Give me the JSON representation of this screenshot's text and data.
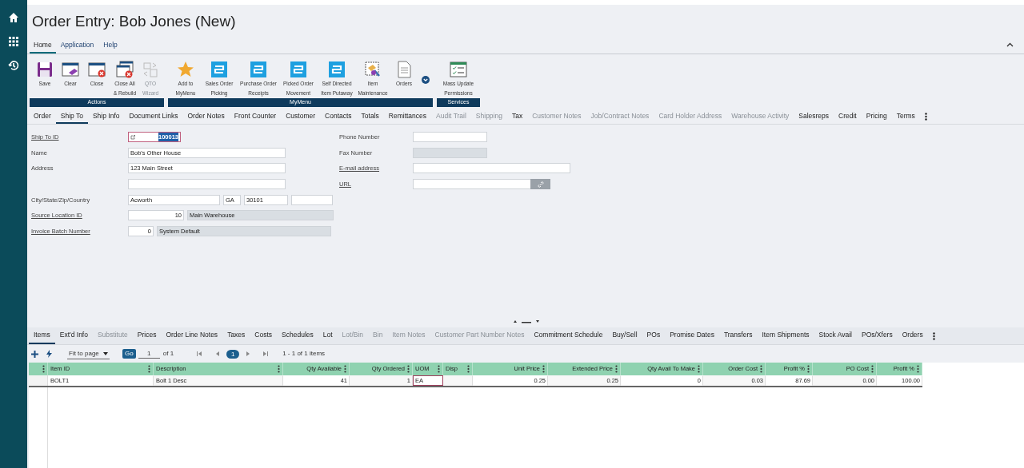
{
  "title": "Order Entry: Bob Jones (New)",
  "menu_tabs": [
    {
      "label": "Home",
      "selected": true
    },
    {
      "label": "Application",
      "selected": false
    },
    {
      "label": "Help",
      "selected": false
    }
  ],
  "ribbon": [
    {
      "label": "Actions",
      "buttons": [
        {
          "kind": "save",
          "label": "Save",
          "disabled": false
        },
        {
          "kind": "clear",
          "label": "Clear",
          "disabled": false
        },
        {
          "kind": "close",
          "label": "Close",
          "disabled": false
        },
        {
          "kind": "closeall",
          "label": "Close All\n& Rebuild",
          "disabled": false
        },
        {
          "kind": "qto",
          "label": "QTO\nWizard",
          "disabled": true
        }
      ]
    },
    {
      "label": "MyMenu",
      "more": true,
      "buttons": [
        {
          "kind": "star",
          "label": "Add to\nMyMenu",
          "disabled": false
        },
        {
          "kind": "tile",
          "label": "Sales Order\nPicking",
          "disabled": false
        },
        {
          "kind": "tile",
          "label": "Purchase Order\nReceipts",
          "disabled": false
        },
        {
          "kind": "tile",
          "label": "Picked Order\nMovement",
          "disabled": false
        },
        {
          "kind": "tile",
          "label": "Self Directed\nItem Putaway",
          "disabled": false
        },
        {
          "kind": "item",
          "label": "Item\nMaintenance",
          "disabled": false
        },
        {
          "kind": "doc",
          "label": "Orders",
          "disabled": false
        }
      ]
    },
    {
      "label": "Services",
      "buttons": [
        {
          "kind": "checklist",
          "label": "Mass Update\nPermissions",
          "disabled": false
        }
      ]
    }
  ],
  "tabs": [
    {
      "label": "Order",
      "selected": false,
      "disabled": false
    },
    {
      "label": "Ship To",
      "selected": true,
      "disabled": false
    },
    {
      "label": "Ship Info",
      "selected": false,
      "disabled": false
    },
    {
      "label": "Document Links",
      "selected": false,
      "disabled": false
    },
    {
      "label": "Order Notes",
      "selected": false,
      "disabled": false
    },
    {
      "label": "Front Counter",
      "selected": false,
      "disabled": false
    },
    {
      "label": "Customer",
      "selected": false,
      "disabled": false
    },
    {
      "label": "Contacts",
      "selected": false,
      "disabled": false
    },
    {
      "label": "Totals",
      "selected": false,
      "disabled": false
    },
    {
      "label": "Remittances",
      "selected": false,
      "disabled": false
    },
    {
      "label": "Audit Trail",
      "selected": false,
      "disabled": true
    },
    {
      "label": "Shipping",
      "selected": false,
      "disabled": true
    },
    {
      "label": "Tax",
      "selected": false,
      "disabled": false
    },
    {
      "label": "Customer Notes",
      "selected": false,
      "disabled": true
    },
    {
      "label": "Job/Contract Notes",
      "selected": false,
      "disabled": true
    },
    {
      "label": "Card Holder Address",
      "selected": false,
      "disabled": true
    },
    {
      "label": "Warehouse Activity",
      "selected": false,
      "disabled": true
    },
    {
      "label": "Salesreps",
      "selected": false,
      "disabled": false
    },
    {
      "label": "Credit",
      "selected": false,
      "disabled": false
    },
    {
      "label": "Pricing",
      "selected": false,
      "disabled": false
    },
    {
      "label": "Terms",
      "selected": false,
      "disabled": false
    }
  ],
  "form_left": [
    {
      "label": "Ship To ID",
      "link": true,
      "inputs": [
        {
          "kind": "lookup",
          "value": "100013",
          "focused": true
        }
      ]
    },
    {
      "label": "Name",
      "link": false,
      "inputs": [
        {
          "kind": "text",
          "value": "Bob's Other House",
          "focused": false
        }
      ]
    },
    {
      "label": "Address",
      "link": false,
      "inputs": [
        {
          "kind": "text",
          "value": "123 Main Street",
          "focused": false
        }
      ]
    },
    {
      "inputs": [
        {
          "kind": "text",
          "focused": false
        }
      ]
    },
    {
      "label": "City/State/Zip/Country",
      "link": false,
      "inputs": [
        {
          "kind": "text",
          "value": "Acworth",
          "focused": false
        },
        {
          "kind": "text",
          "value": "GA",
          "focused": false
        },
        {
          "kind": "text",
          "value": "30101",
          "focused": false
        },
        {
          "kind": "text",
          "focused": false
        }
      ]
    },
    {
      "label": "Source Location ID",
      "link": true,
      "inputs": [
        {
          "kind": "number",
          "value": "10",
          "focused": false
        },
        {
          "kind": "readonly",
          "value": "Main Warehouse",
          "focused": false
        }
      ]
    },
    {
      "label": "Invoice Batch Number",
      "link": true,
      "inputs": [
        {
          "kind": "number",
          "value": "0",
          "focused": false
        },
        {
          "kind": "readonly",
          "value": "System Default",
          "focused": false
        }
      ]
    }
  ],
  "form_right": [
    {
      "label": "Phone Number",
      "link": false,
      "inputs": [
        {
          "kind": "text",
          "focused": false
        }
      ]
    },
    {
      "label": "Fax Number",
      "link": false,
      "inputs": [
        {
          "kind": "readonly",
          "focused": false
        }
      ]
    },
    {
      "label": "E-mail address",
      "link": true,
      "inputs": [
        {
          "kind": "text",
          "focused": false
        }
      ]
    },
    {
      "label": "URL",
      "link": true,
      "inputs": [
        {
          "kind": "url",
          "focused": false
        }
      ]
    }
  ],
  "item_tabs": [
    {
      "label": "Items",
      "selected": true,
      "disabled": false
    },
    {
      "label": "Ext'd Info",
      "selected": false,
      "disabled": false
    },
    {
      "label": "Substitute",
      "selected": false,
      "disabled": true
    },
    {
      "label": "Prices",
      "selected": false,
      "disabled": false
    },
    {
      "label": "Order Line Notes",
      "selected": false,
      "disabled": false
    },
    {
      "label": "Taxes",
      "selected": false,
      "disabled": false
    },
    {
      "label": "Costs",
      "selected": false,
      "disabled": false
    },
    {
      "label": "Schedules",
      "selected": false,
      "disabled": false
    },
    {
      "label": "Lot",
      "selected": false,
      "disabled": false
    },
    {
      "label": "Lot/Bin",
      "selected": false,
      "disabled": true
    },
    {
      "label": "Bin",
      "selected": false,
      "disabled": true
    },
    {
      "label": "Item Notes",
      "selected": false,
      "disabled": true
    },
    {
      "label": "Customer Part Number Notes",
      "selected": false,
      "disabled": true
    },
    {
      "label": "Commitment Schedule",
      "selected": false,
      "disabled": false
    },
    {
      "label": "Buy/Sell",
      "selected": false,
      "disabled": false
    },
    {
      "label": "POs",
      "selected": false,
      "disabled": false
    },
    {
      "label": "Promise Dates",
      "selected": false,
      "disabled": false
    },
    {
      "label": "Transfers",
      "selected": false,
      "disabled": false
    },
    {
      "label": "Item Shipments",
      "selected": false,
      "disabled": false
    },
    {
      "label": "Stock Avail",
      "selected": false,
      "disabled": false
    },
    {
      "label": "POs/Xfers",
      "selected": false,
      "disabled": false
    },
    {
      "label": "Orders",
      "selected": false,
      "disabled": false
    }
  ],
  "pager": {
    "page_size": "Fit to page",
    "go": "Go",
    "page": "1",
    "of": "of 1",
    "current": "1",
    "summary": "1 - 1 of 1 items"
  },
  "grid": {
    "columns": [
      "Item ID",
      "Description",
      "Qty Available",
      "Qty Ordered",
      "UOM",
      "Disp",
      "Unit Price",
      "Extended Price",
      "Qty Avail To Make",
      "Order Cost",
      "Profit %",
      "PO Cost",
      "Profit %"
    ],
    "rows": [
      {
        "cells": [
          {
            "text": "BOLT1",
            "focused": false
          },
          {
            "text": "Bolt 1 Desc",
            "focused": false
          },
          {
            "text": "41",
            "focused": false
          },
          {
            "text": "1",
            "focused": false
          },
          {
            "text": "EA",
            "focused": true
          },
          {
            "focused": false
          },
          {
            "text": "0.25",
            "focused": false
          },
          {
            "text": "0.25",
            "focused": false
          },
          {
            "text": "0",
            "focused": false
          },
          {
            "text": "0.03",
            "focused": false
          },
          {
            "text": "87.69",
            "focused": false
          },
          {
            "text": "0.00",
            "focused": false
          },
          {
            "text": "100.00",
            "focused": false
          }
        ]
      }
    ]
  }
}
